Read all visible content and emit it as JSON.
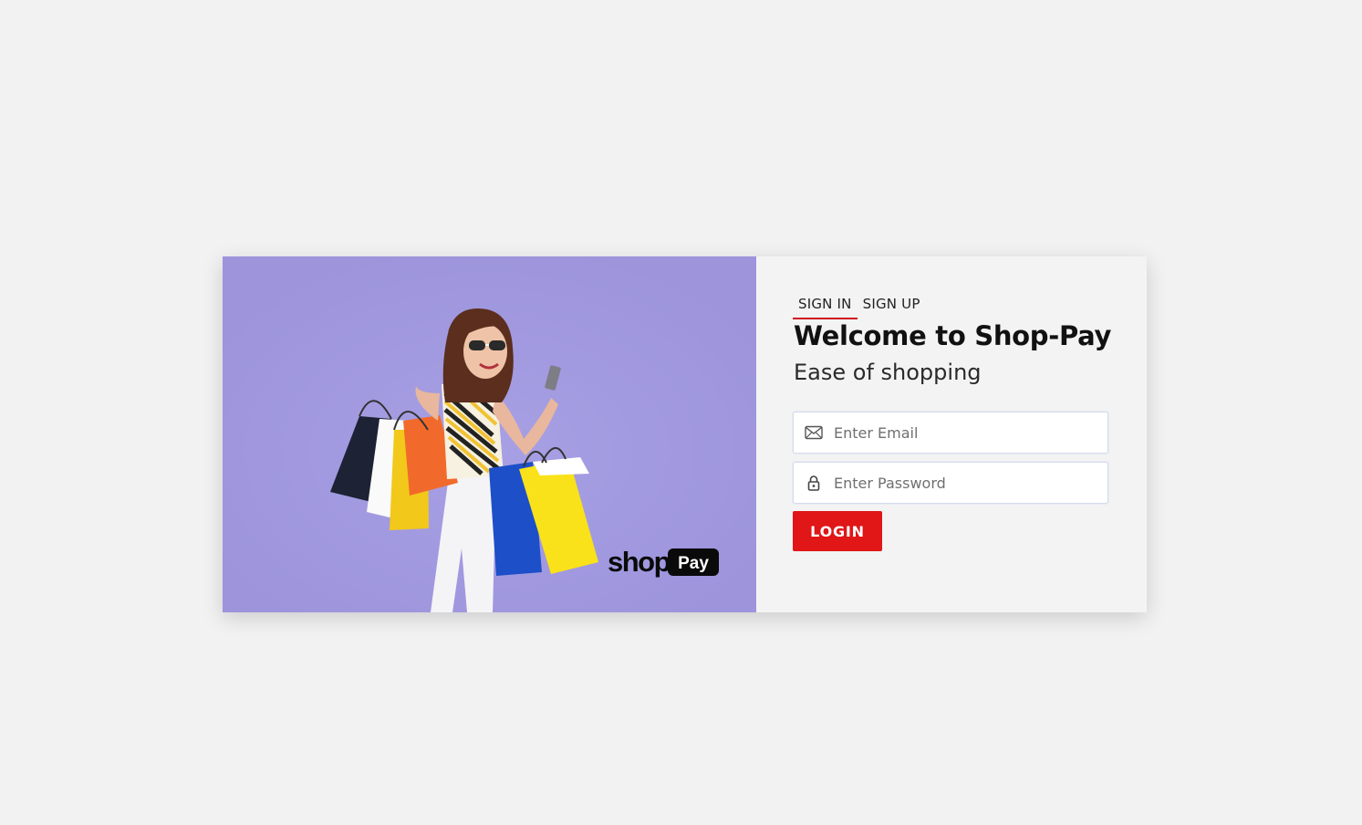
{
  "tabs": [
    {
      "label": "SIGN IN",
      "active": true
    },
    {
      "label": "SIGN UP",
      "active": false
    }
  ],
  "title": "Welcome to Shop-Pay",
  "subtitle": "Ease of shopping",
  "email": {
    "placeholder": "Enter Email",
    "value": "",
    "icon": "envelope-icon"
  },
  "password": {
    "placeholder": "Enter Password",
    "value": "",
    "icon": "lock-icon"
  },
  "login_label": "LOGIN",
  "logo": {
    "shop": "shop",
    "pay": "Pay"
  },
  "colors": {
    "accent": "#e01617",
    "hero_bg": "#a29ae0",
    "page_bg": "#f2f2f2"
  }
}
